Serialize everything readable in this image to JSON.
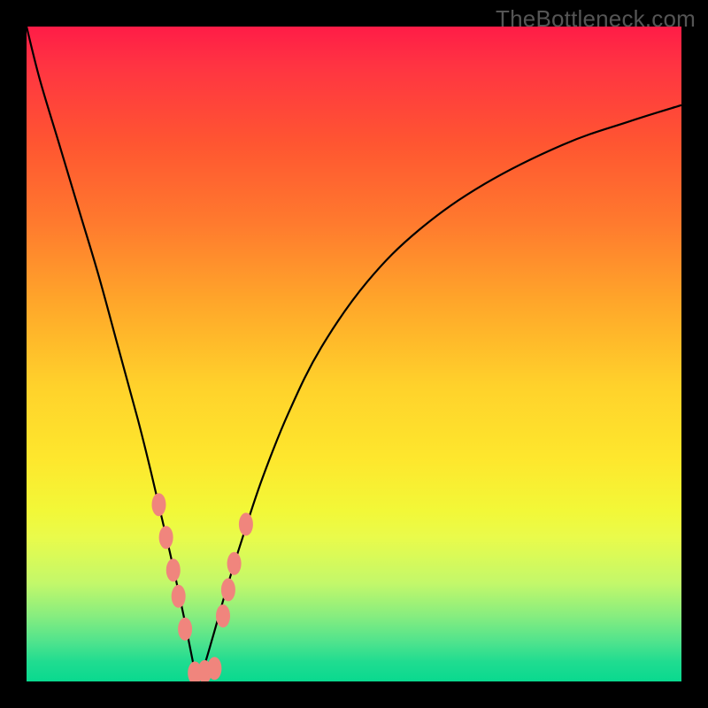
{
  "watermark": {
    "text": "TheBottleneck.com"
  },
  "chart_data": {
    "type": "line",
    "title": "",
    "xlabel": "",
    "ylabel": "",
    "xlim": [
      0,
      100
    ],
    "ylim": [
      0,
      100
    ],
    "series": [
      {
        "name": "curve-left",
        "x": [
          0,
          2,
          5,
          8,
          11,
          14,
          17,
          19,
          21,
          22.5,
          24,
          25,
          25.6,
          26
        ],
        "y": [
          100,
          92,
          82,
          72,
          62,
          51,
          40,
          32,
          23.5,
          17,
          10,
          5,
          2,
          0
        ]
      },
      {
        "name": "curve-right",
        "x": [
          26,
          27,
          28.5,
          30.5,
          33,
          36,
          40,
          45,
          52,
          60,
          70,
          82,
          92,
          100
        ],
        "y": [
          0,
          2,
          7,
          14,
          22,
          31,
          41,
          51,
          61,
          69,
          76,
          82,
          85.5,
          88
        ]
      }
    ],
    "beads": [
      {
        "x": 20.2,
        "y": 27
      },
      {
        "x": 21.3,
        "y": 22
      },
      {
        "x": 22.4,
        "y": 17
      },
      {
        "x": 23.2,
        "y": 13
      },
      {
        "x": 24.2,
        "y": 8
      },
      {
        "x": 25.7,
        "y": 1.3
      },
      {
        "x": 27.2,
        "y": 1.5
      },
      {
        "x": 28.7,
        "y": 2.0
      },
      {
        "x": 30.0,
        "y": 10
      },
      {
        "x": 30.8,
        "y": 14
      },
      {
        "x": 31.7,
        "y": 18
      },
      {
        "x": 33.5,
        "y": 24
      }
    ],
    "gradient_colors": {
      "top": "#ff1c47",
      "mid_upper": "#ff9a2c",
      "mid": "#fee72d",
      "mid_lower": "#c3f86a",
      "bottom": "#09d98f"
    },
    "curve_minimum": {
      "x": 26,
      "y": 0
    }
  }
}
